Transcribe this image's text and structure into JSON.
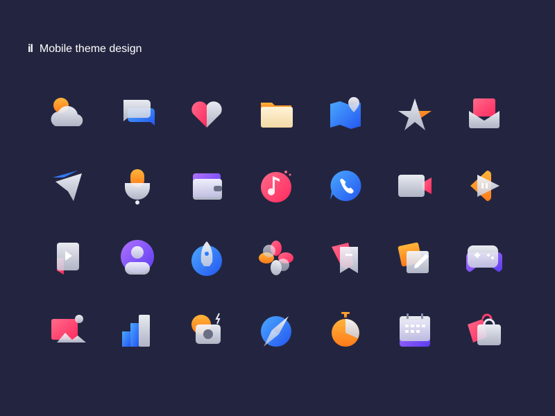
{
  "header": {
    "brand_mark": "il",
    "title": "Mobile theme design"
  },
  "icons": [
    "weather-icon",
    "message-icon",
    "heart-icon",
    "folder-icon",
    "map-icon",
    "star-icon",
    "mail-icon",
    "send-icon",
    "microphone-icon",
    "wallet-icon",
    "music-icon",
    "phone-icon",
    "video-icon",
    "play-store-icon",
    "video-player-icon",
    "contacts-icon",
    "rocket-icon",
    "photos-flower-icon",
    "notes-icon",
    "edit-icon",
    "game-controller-icon",
    "gallery-icon",
    "stats-icon",
    "camera-icon",
    "compass-icon",
    "timer-icon",
    "calendar-icon",
    "shopping-icon"
  ],
  "colors": {
    "background": "#232540",
    "orange": "#ff9a1f",
    "pink": "#ff3d6e",
    "blue": "#2e7bff",
    "purple": "#7b4dff",
    "glass": "#e9ecf5"
  }
}
